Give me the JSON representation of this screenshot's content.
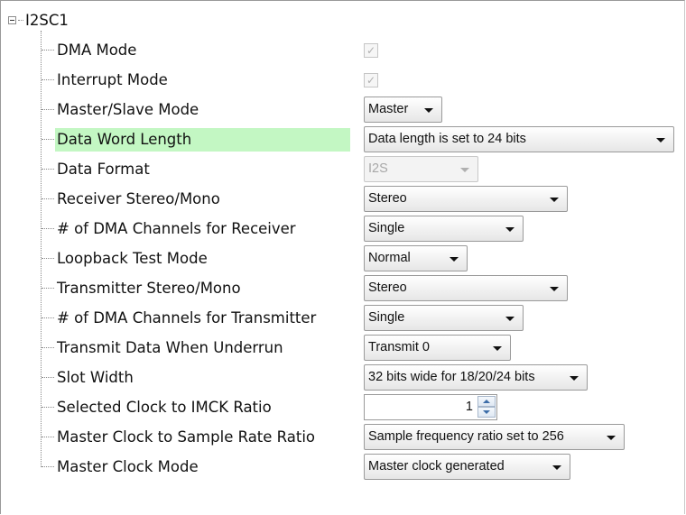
{
  "tree": {
    "root_label": "I2SC1",
    "rows": [
      {
        "label": "DMA Mode",
        "control": "checkbox",
        "checked": true
      },
      {
        "label": "Interrupt Mode",
        "control": "checkbox",
        "checked": true
      },
      {
        "label": "Master/Slave Mode",
        "control": "dropdown",
        "value": "Master"
      },
      {
        "label": "Data Word Length",
        "control": "dropdown",
        "value": "Data length is set to 24 bits",
        "highlighted": true
      },
      {
        "label": "Data Format",
        "control": "dropdown",
        "value": "I2S",
        "disabled": true
      },
      {
        "label": "Receiver Stereo/Mono",
        "control": "dropdown",
        "value": "Stereo"
      },
      {
        "label": "# of DMA Channels for Receiver",
        "control": "dropdown",
        "value": "Single"
      },
      {
        "label": "Loopback Test Mode",
        "control": "dropdown",
        "value": "Normal"
      },
      {
        "label": "Transmitter Stereo/Mono",
        "control": "dropdown",
        "value": "Stereo"
      },
      {
        "label": "# of DMA Channels for Transmitter",
        "control": "dropdown",
        "value": "Single"
      },
      {
        "label": "Transmit Data When Underrun",
        "control": "dropdown",
        "value": "Transmit 0"
      },
      {
        "label": "Slot Width",
        "control": "dropdown",
        "value": "32 bits wide for 18/20/24 bits"
      },
      {
        "label": "Selected Clock to IMCK Ratio",
        "control": "spinner",
        "value": "1"
      },
      {
        "label": "Master Clock to Sample Rate Ratio",
        "control": "dropdown",
        "value": "Sample frequency ratio set to 256"
      },
      {
        "label": "Master Clock Mode",
        "control": "dropdown",
        "value": "Master clock generated"
      }
    ]
  },
  "colors": {
    "highlight": "#c3f7c3",
    "spinner_arrow": "#3c6da8"
  }
}
